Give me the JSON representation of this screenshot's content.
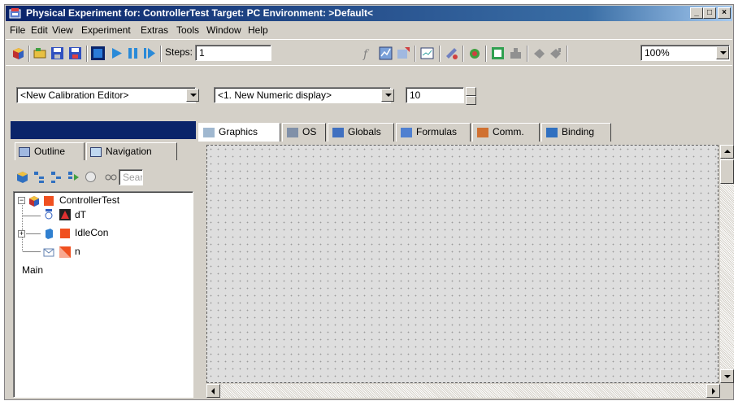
{
  "window": {
    "title": "Physical Experiment for: ControllerTest  Target: PC  Environment: >Default<",
    "controls": [
      "_",
      "□",
      "×"
    ]
  },
  "menu": [
    "File",
    "Edit",
    "View",
    "Experiment",
    "Extras",
    "Tools",
    "Window",
    "Help"
  ],
  "toolbar": {
    "steps_label": "Steps:",
    "steps_value": "1",
    "zoom_value": "100%",
    "icons": [
      "cube-icon",
      "open-folder-icon",
      "save-icon",
      "save-all-icon",
      "stop-icon",
      "play-icon",
      "pause-icon",
      "step-icon",
      "formula-icon",
      "graph-icon",
      "wizard-icon",
      "chart-icon",
      "connect-icon",
      "download-icon",
      "export-icon",
      "target-icon",
      "disconnect-icon",
      "connect-target-icon"
    ]
  },
  "toolbar2": {
    "calibration_editor": "<New Calibration Editor>",
    "numeric_display": "<1. New Numeric display>",
    "spin_value": "10"
  },
  "left_panel": {
    "tabs": [
      "Outline",
      "Navigation"
    ],
    "search_placeholder": "Sear",
    "tree": [
      {
        "label": "ControllerTest",
        "expander": "−"
      },
      {
        "label": "dT"
      },
      {
        "label": "IdleCon",
        "expander": "+"
      },
      {
        "label": "n"
      },
      {
        "label": "Main"
      }
    ]
  },
  "right_tabs": [
    "Graphics",
    "OS",
    "Globals",
    "Formulas",
    "Comm.",
    "Binding"
  ],
  "colors": {
    "title_start": "#0a246a",
    "title_end": "#a6caf0",
    "face": "#d4d0c8",
    "selection": "#0a246a"
  }
}
